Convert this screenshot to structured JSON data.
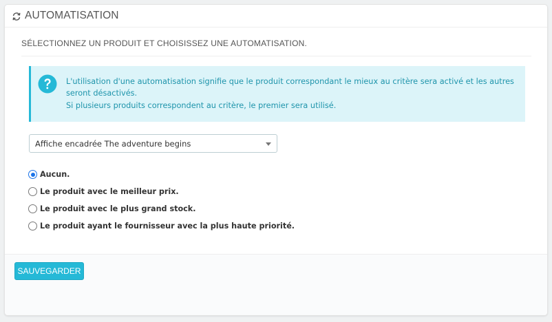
{
  "panel": {
    "title": "AUTOMATISATION",
    "icon": "refresh-icon"
  },
  "subtitle": "SÉLECTIONNEZ UN PRODUIT ET CHOISISSEZ UNE AUTOMATISATION.",
  "alert": {
    "icon": "question-icon",
    "line1": "L'utilisation d'une automatisation signifie que le produit correspondant le mieux au critère sera activé et les autres seront désactivés.",
    "line2": "Si plusieurs produits correspondent au critère, le premier sera utilisé.",
    "color": "#25b9d7"
  },
  "product_select": {
    "value": "Affiche encadrée The adventure begins"
  },
  "options": [
    {
      "label": "Aucun.",
      "checked": true
    },
    {
      "label": "Le produit avec le meilleur prix.",
      "checked": false
    },
    {
      "label": "Le produit avec le plus grand stock.",
      "checked": false
    },
    {
      "label": "Le produit ayant le fournisseur avec la plus haute priorité.",
      "checked": false
    }
  ],
  "footer": {
    "save_label": "SAUVEGARDER"
  },
  "colors": {
    "accent": "#25b9d7",
    "alert_bg": "#dcf4f9",
    "alert_text": "#1e94ab"
  }
}
